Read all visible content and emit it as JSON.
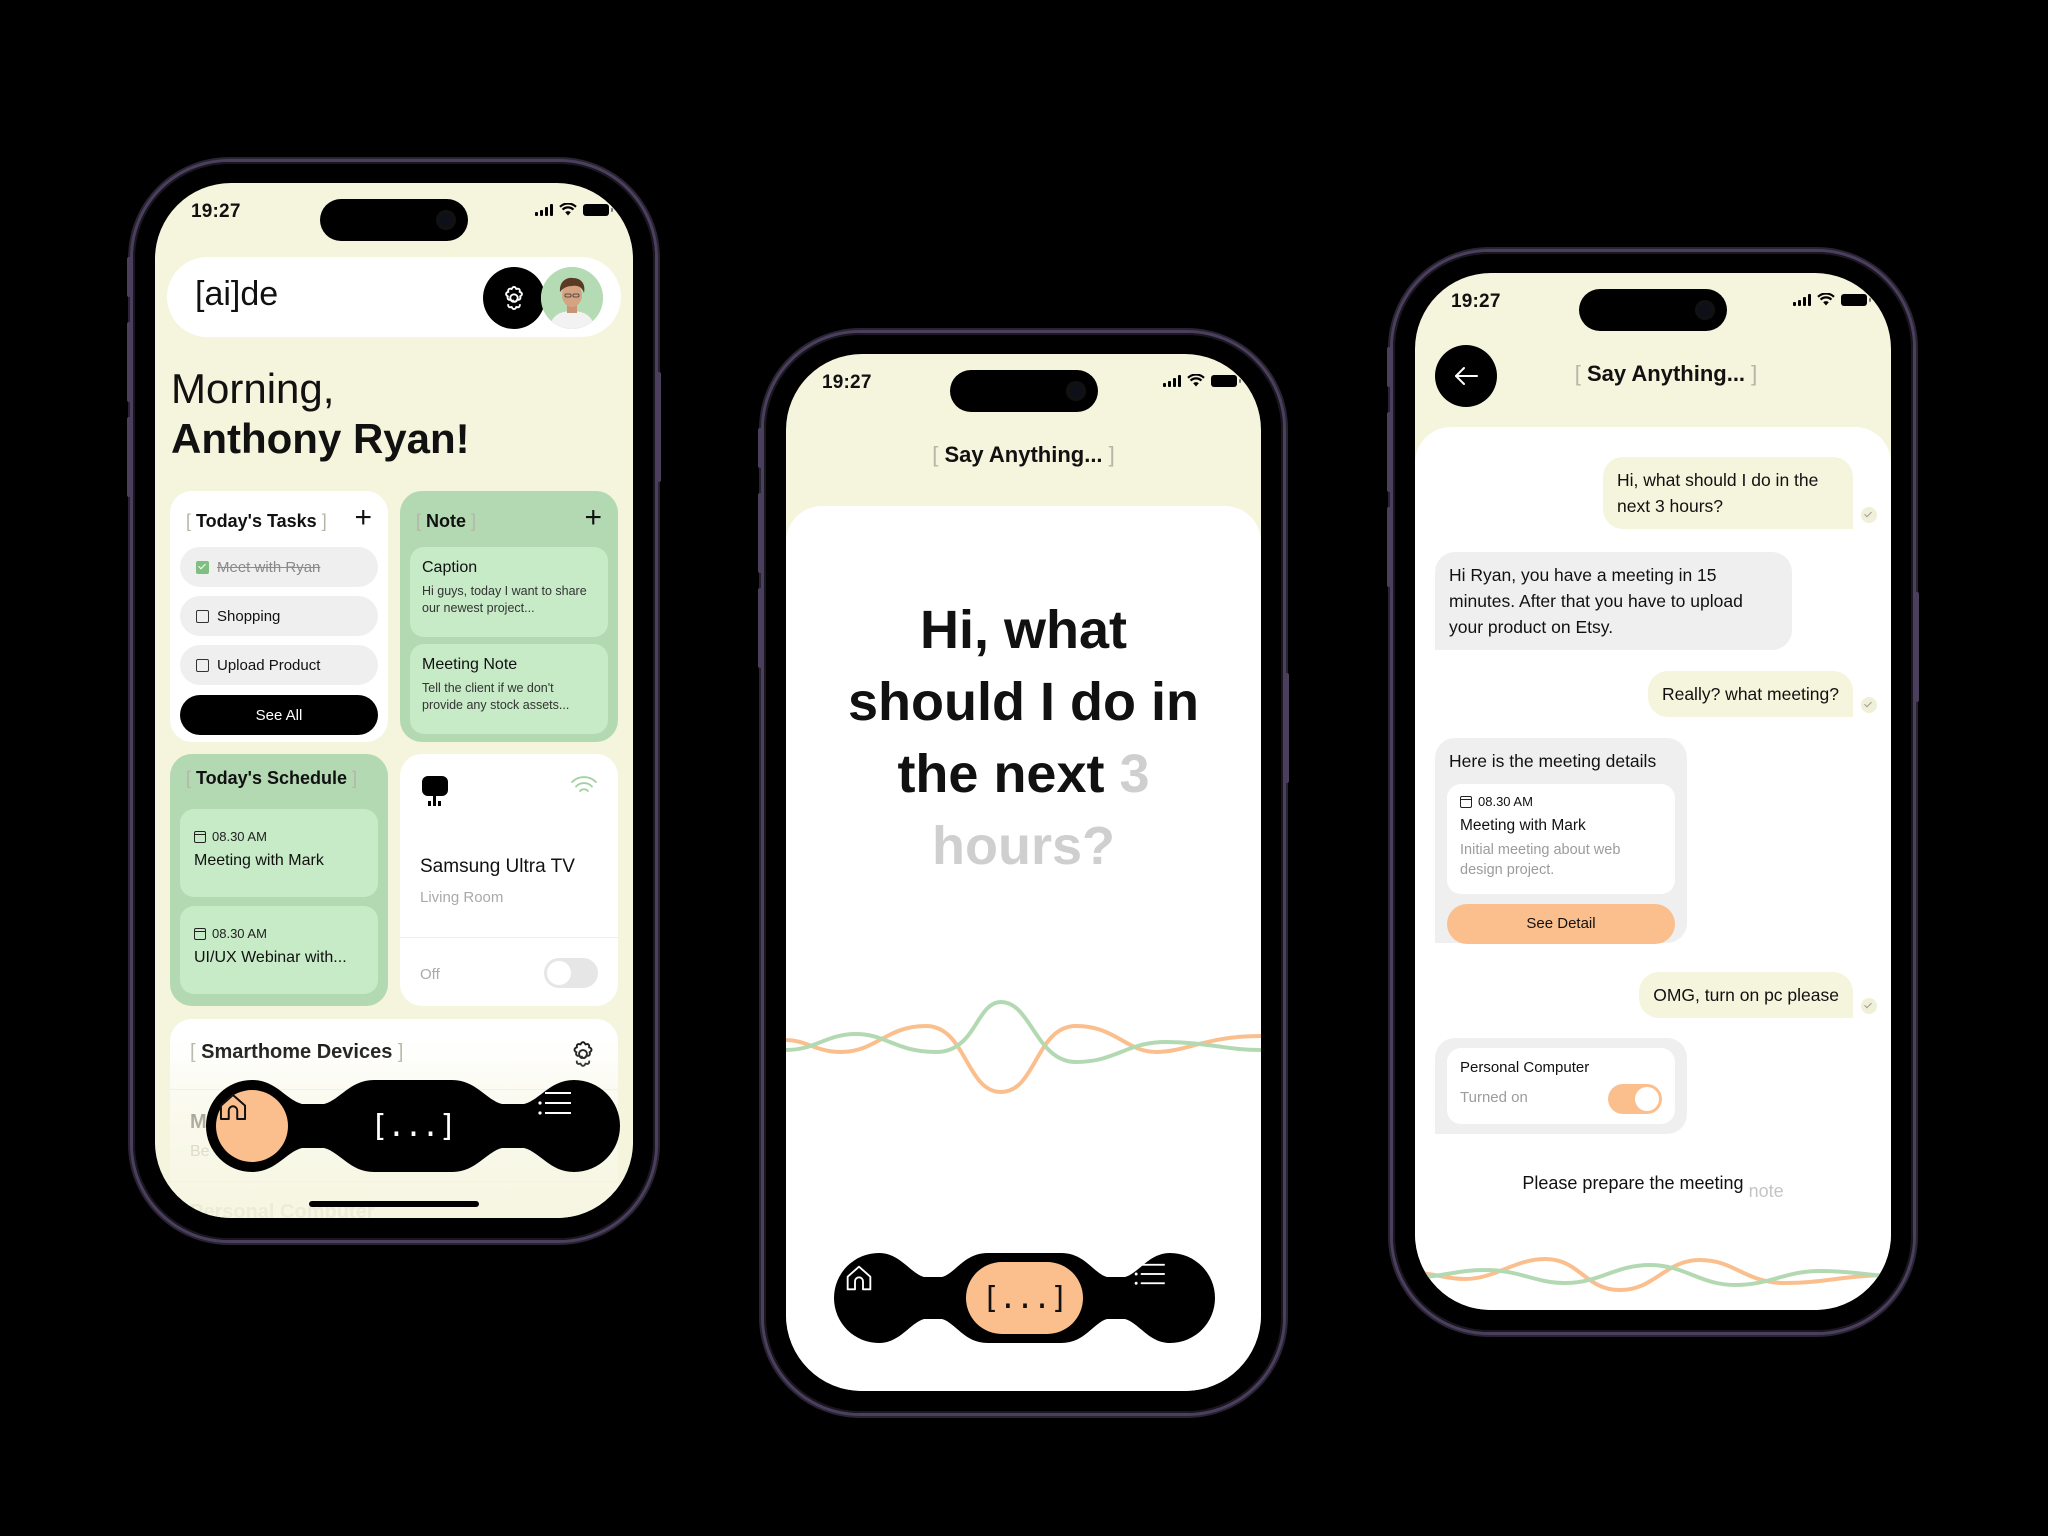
{
  "status_bar": {
    "time": "19:27"
  },
  "home_screen": {
    "brand": "[ai]de",
    "greeting_line1": "Morning,",
    "greeting_line2": "Anthony Ryan!",
    "tasks": {
      "title": "Today's Tasks",
      "items": [
        {
          "label": "Meet with Ryan",
          "done": true
        },
        {
          "label": "Shopping",
          "done": false
        },
        {
          "label": "Upload Product",
          "done": false
        }
      ],
      "see_all": "See All"
    },
    "note": {
      "title": "Note",
      "items": [
        {
          "title": "Caption",
          "body": "Hi guys, today I want to share our newest project..."
        },
        {
          "title": "Meeting Note",
          "body": "Tell the client if we don't provide any stock assets..."
        }
      ]
    },
    "schedule": {
      "title": "Today's Schedule",
      "items": [
        {
          "time": "08.30 AM",
          "name": "Meeting with Mark"
        },
        {
          "time": "08.30 AM",
          "name": "UI/UX Webinar with..."
        }
      ]
    },
    "tv_card": {
      "name": "Samsung Ultra TV",
      "room": "Living Room",
      "state": "Off",
      "on": false
    },
    "smarthome": {
      "title": "Smarthome Devices",
      "devices": [
        {
          "name": "M",
          "room": "Be"
        },
        {
          "name": "Personal Computer",
          "room": ""
        }
      ]
    }
  },
  "nav": {
    "home_icon": "home-icon",
    "assistant_label": "[...]",
    "menu_icon": "list-icon"
  },
  "voice_screen": {
    "title": "Say Anything...",
    "prompt_spoken": "Hi, what should I do in the next",
    "prompt_pending_1": "3",
    "prompt_pending_2": "hours?"
  },
  "chat_screen": {
    "title": "Say Anything...",
    "messages": [
      {
        "from": "user",
        "text": "Hi, what should I do in the next 3 hours?"
      },
      {
        "from": "bot",
        "text": "Hi Ryan, you have a meeting in 15 minutes. After that you have to upload your product on Etsy."
      },
      {
        "from": "user",
        "text": "Really? what meeting?"
      },
      {
        "from": "bot",
        "text": "Here is the meeting details",
        "card": {
          "time": "08.30 AM",
          "title": "Meeting with Mark",
          "desc": "Initial meeting about web design project.",
          "button": "See Detail"
        }
      },
      {
        "from": "user",
        "text": "OMG, turn on pc please"
      },
      {
        "from": "bot",
        "device": {
          "name": "Personal Computer",
          "state": "Turned on",
          "on": true
        }
      }
    ],
    "transcript_spoken": "Please prepare the meeting",
    "transcript_pending": "note"
  },
  "colors": {
    "cream": "#f5f4dc",
    "green": "#b3d9b3",
    "green_light": "#c7eac7",
    "peach": "#fbbf8e",
    "black": "#000000"
  }
}
